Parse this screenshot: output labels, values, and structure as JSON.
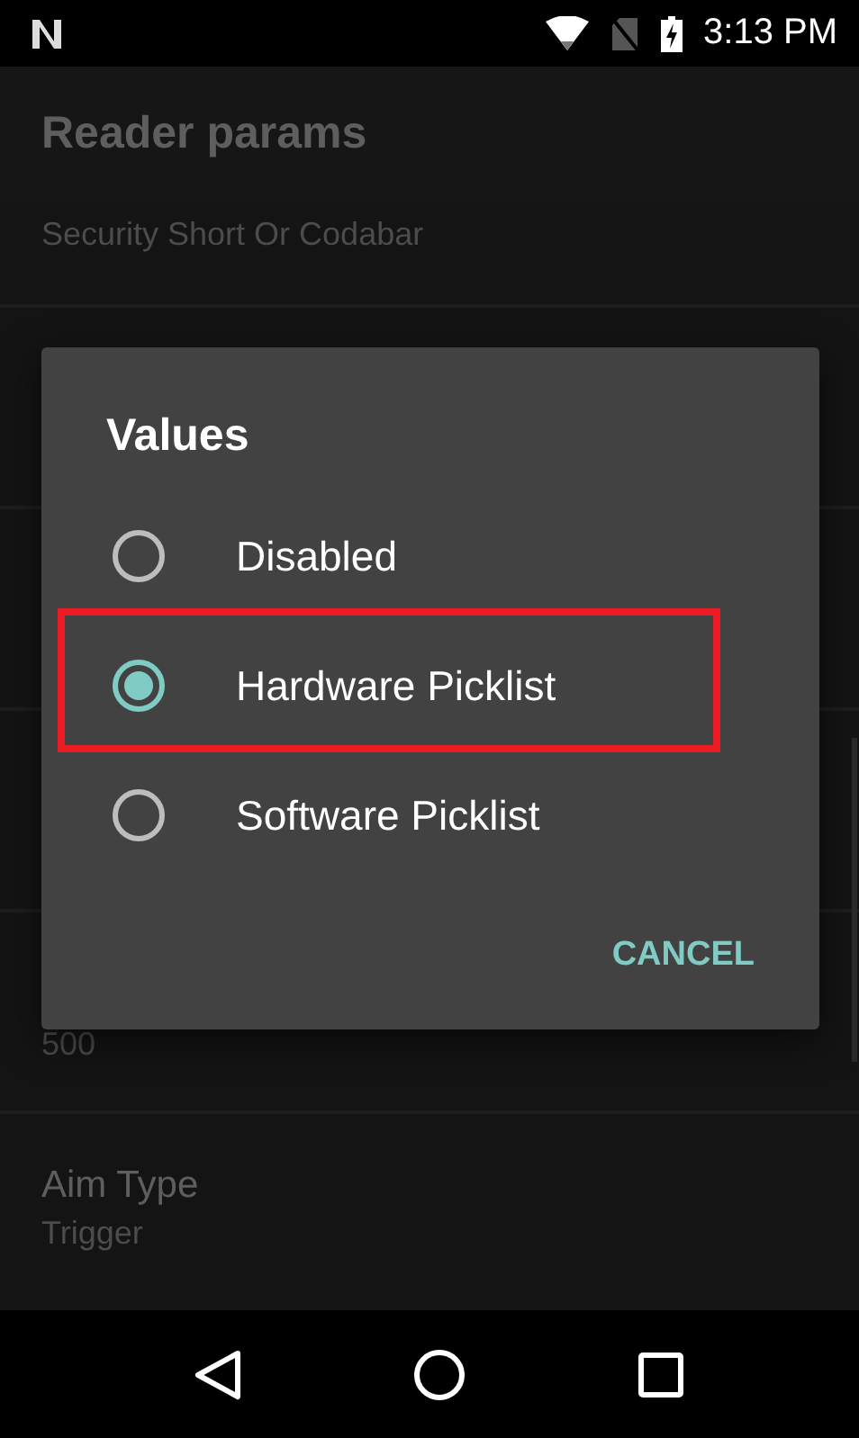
{
  "status_bar": {
    "time": "3:13 PM"
  },
  "app_bar": {
    "title": "Reader params"
  },
  "settings": [
    {
      "summary": "Security Short Or Codabar"
    },
    {
      "summary": "500"
    },
    {
      "title": "Aim Type",
      "summary": "Trigger"
    }
  ],
  "dialog": {
    "title": "Values",
    "options": [
      {
        "label": "Disabled",
        "selected": false
      },
      {
        "label": "Hardware Picklist",
        "selected": true
      },
      {
        "label": "Software Picklist",
        "selected": false
      }
    ],
    "buttons": [
      "CANCEL"
    ]
  }
}
